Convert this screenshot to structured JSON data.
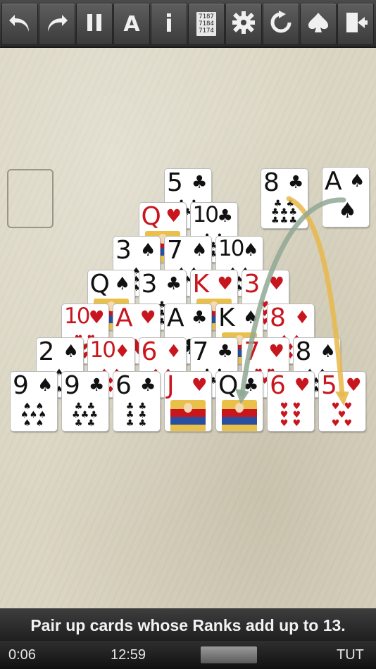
{
  "toolbar": {
    "buttons": [
      {
        "name": "undo-button",
        "icon": "undo-icon"
      },
      {
        "name": "redo-button",
        "icon": "redo-icon"
      },
      {
        "name": "pause-button",
        "icon": "pause-icon"
      },
      {
        "name": "auto-button",
        "icon": "auto-icon",
        "label": "A"
      },
      {
        "name": "info-button",
        "icon": "info-icon",
        "label": "i"
      },
      {
        "name": "stats-button",
        "icon": "stats-icon",
        "lines": [
          "7187",
          "7184",
          "7174"
        ]
      },
      {
        "name": "settings-button",
        "icon": "gear-icon"
      },
      {
        "name": "restart-button",
        "icon": "restart-icon"
      },
      {
        "name": "game-select-button",
        "icon": "spade-icon"
      },
      {
        "name": "exit-button",
        "icon": "exit-door-icon"
      }
    ]
  },
  "colors": {
    "red_suit": "#c8161f",
    "black_suit": "#111111"
  },
  "pyramid": [
    [
      {
        "rank": "5",
        "suit": "♣"
      }
    ],
    [
      {
        "rank": "Q",
        "suit": "♥"
      },
      {
        "rank": "10",
        "suit": "♣"
      }
    ],
    [
      {
        "rank": "3",
        "suit": "♠"
      },
      {
        "rank": "7",
        "suit": "♠"
      },
      {
        "rank": "10",
        "suit": "♠"
      }
    ],
    [
      {
        "rank": "Q",
        "suit": "♠"
      },
      {
        "rank": "3",
        "suit": "♣"
      },
      {
        "rank": "K",
        "suit": "♥"
      },
      {
        "rank": "3",
        "suit": "♥"
      }
    ],
    [
      {
        "rank": "10",
        "suit": "♥"
      },
      {
        "rank": "A",
        "suit": "♥"
      },
      {
        "rank": "A",
        "suit": "♣"
      },
      {
        "rank": "K",
        "suit": "♠"
      },
      {
        "rank": "8",
        "suit": "♦"
      }
    ],
    [
      {
        "rank": "2",
        "suit": "♠"
      },
      {
        "rank": "10",
        "suit": "♦"
      },
      {
        "rank": "6",
        "suit": "♦"
      },
      {
        "rank": "7",
        "suit": "♣"
      },
      {
        "rank": "7",
        "suit": "♥"
      },
      {
        "rank": "8",
        "suit": "♠"
      }
    ],
    [
      {
        "rank": "9",
        "suit": "♠"
      },
      {
        "rank": "9",
        "suit": "♣"
      },
      {
        "rank": "6",
        "suit": "♣"
      },
      {
        "rank": "J",
        "suit": "♥"
      },
      {
        "rank": "Q",
        "suit": "♣"
      },
      {
        "rank": "6",
        "suit": "♥"
      },
      {
        "rank": "5",
        "suit": "♥"
      }
    ]
  ],
  "stock_card": {
    "rank": "8",
    "suit": "♣"
  },
  "waste_card": {
    "rank": "A",
    "suit": "♠"
  },
  "message": "Pair up cards whose Ranks add up to 13.",
  "status": {
    "time": "0:06",
    "clock": "12:59",
    "mode": "TUT"
  }
}
